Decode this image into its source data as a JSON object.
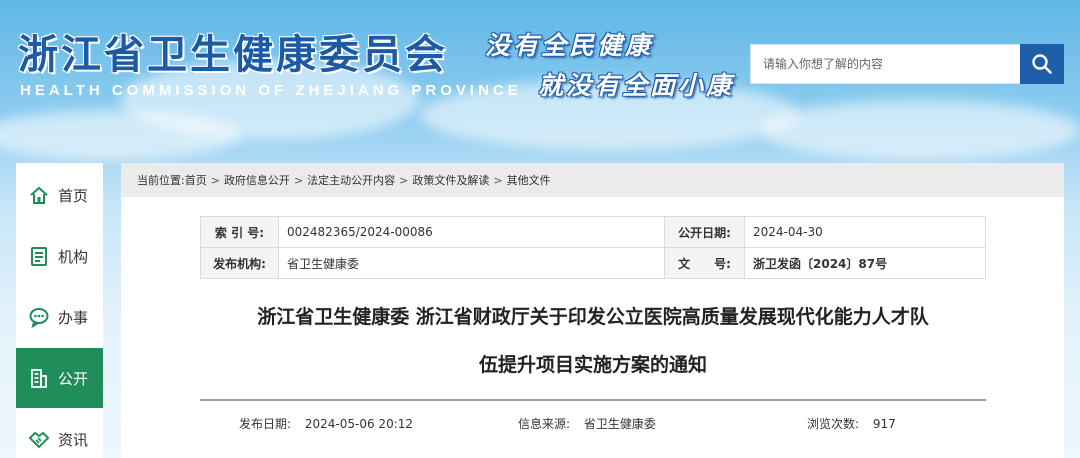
{
  "header": {
    "title_cn": "浙江省卫生健康委员会",
    "title_en": "HEALTH COMMISSION OF ZHEJIANG PROVINCE",
    "slogan_line1": "没有全民健康",
    "slogan_line2": "就没有全面小康"
  },
  "search": {
    "placeholder": "请输入你想了解的内容",
    "button_icon": "search-icon"
  },
  "nav": {
    "items": [
      {
        "label": "首页",
        "icon": "home-icon"
      },
      {
        "label": "机构",
        "icon": "document-icon"
      },
      {
        "label": "办事",
        "icon": "chat-icon"
      },
      {
        "label": "公开",
        "icon": "building-icon",
        "active": true
      },
      {
        "label": "资讯",
        "icon": "handshake-icon"
      }
    ],
    "active_color": "#1f8e5a"
  },
  "breadcrumb": {
    "prefix": "当前位置:",
    "items": [
      "首页",
      "政府信息公开",
      "法定主动公开内容",
      "政策文件及解读",
      "其他文件"
    ],
    "separator": ">"
  },
  "meta": {
    "index_label": "索 引 号:",
    "index_value": "002482365/2024-00086",
    "date_label": "公开日期:",
    "date_value": "2024-04-30",
    "org_label": "发布机构:",
    "org_value": "省卫生健康委",
    "doc_label": "文　　号:",
    "doc_value": "浙卫发函〔2024〕87号"
  },
  "article": {
    "title_line1": "浙江省卫生健康委 浙江省财政厅关于印发公立医院高质量发展现代化能力人才队",
    "title_line2": "伍提升项目实施方案的通知",
    "publish_label": "发布日期:",
    "publish_value": "2024-05-06 20:12",
    "source_label": "信息来源:",
    "source_value": "省卫生健康委",
    "views_label": "浏览次数:",
    "views_value": "917"
  },
  "colors": {
    "brand_blue": "#1f5ea8",
    "green_active": "#1f8e5a"
  }
}
